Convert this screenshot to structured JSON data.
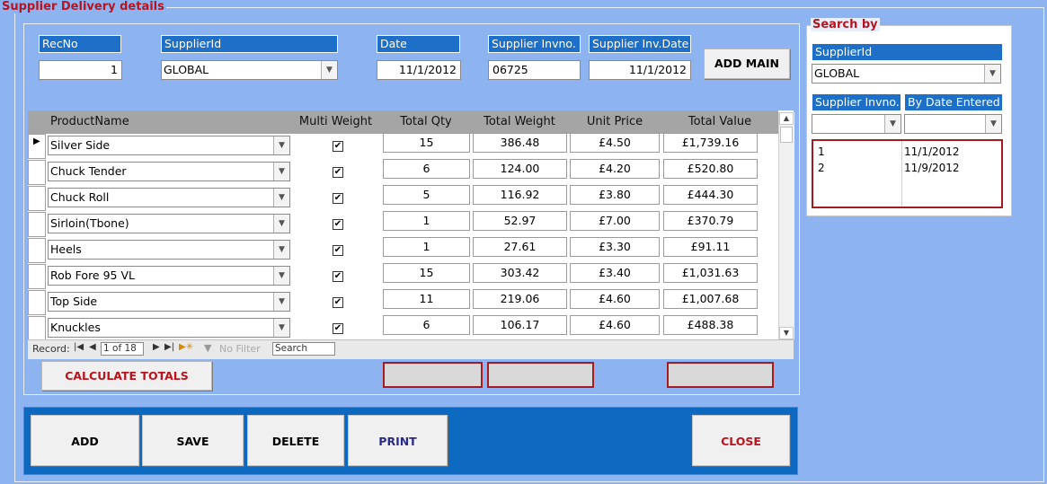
{
  "form": {
    "title": "Supplier Delivery details"
  },
  "header": {
    "recno_label": "RecNo",
    "recno_value": "1",
    "supplier_label": "SupplierId",
    "supplier_value": "GLOBAL",
    "date_label": "Date",
    "date_value": "11/1/2012",
    "invno_label": "Supplier Invno.",
    "invno_value": "06725",
    "invdate_label": "Supplier Inv.Date",
    "invdate_value": "11/1/2012",
    "add_main": "ADD MAIN"
  },
  "grid": {
    "columns": [
      "ProductName",
      "Multi Weight",
      "Total Qty",
      "Total Weight",
      "Unit Price",
      "Total Value"
    ],
    "rows": [
      {
        "product": "Silver Side",
        "multi": true,
        "qty": "15",
        "weight": "386.48",
        "price": "£4.50",
        "value": "£1,739.16"
      },
      {
        "product": "Chuck Tender",
        "multi": true,
        "qty": "6",
        "weight": "124.00",
        "price": "£4.20",
        "value": "£520.80"
      },
      {
        "product": "Chuck Roll",
        "multi": true,
        "qty": "5",
        "weight": "116.92",
        "price": "£3.80",
        "value": "£444.30"
      },
      {
        "product": "Sirloin(Tbone)",
        "multi": true,
        "qty": "1",
        "weight": "52.97",
        "price": "£7.00",
        "value": "£370.79"
      },
      {
        "product": "Heels",
        "multi": true,
        "qty": "1",
        "weight": "27.61",
        "price": "£3.30",
        "value": "£91.11"
      },
      {
        "product": "Rob Fore 95 VL",
        "multi": true,
        "qty": "15",
        "weight": "303.42",
        "price": "£3.40",
        "value": "£1,031.63"
      },
      {
        "product": "Top Side",
        "multi": true,
        "qty": "11",
        "weight": "219.06",
        "price": "£4.60",
        "value": "£1,007.68"
      },
      {
        "product": "Knuckles",
        "multi": true,
        "qty": "6",
        "weight": "106.17",
        "price": "£4.60",
        "value": "£488.38"
      }
    ]
  },
  "navigation": {
    "record_label": "Record:",
    "record_position": "1 of 18",
    "filter_label": "No Filter",
    "search_label": "Search"
  },
  "buttons": {
    "calculate": "CALCULATE TOTALS",
    "add": "ADD",
    "save": "SAVE",
    "delete": "DELETE",
    "print": "PRINT",
    "close": "CLOSE"
  },
  "search": {
    "title": "Search  by",
    "supplier_label": "SupplierId",
    "supplier_value": "GLOBAL",
    "invno_label": "Supplier Invno.",
    "bydate_label": "By Date Entered",
    "results": [
      {
        "id": "1",
        "date": "11/1/2012"
      },
      {
        "id": "2",
        "date": "11/9/2012"
      }
    ]
  },
  "colors": {
    "accent": "#1e6fc7",
    "danger": "#b8141e",
    "background": "#8db4f0",
    "bar": "#0d68bf"
  }
}
